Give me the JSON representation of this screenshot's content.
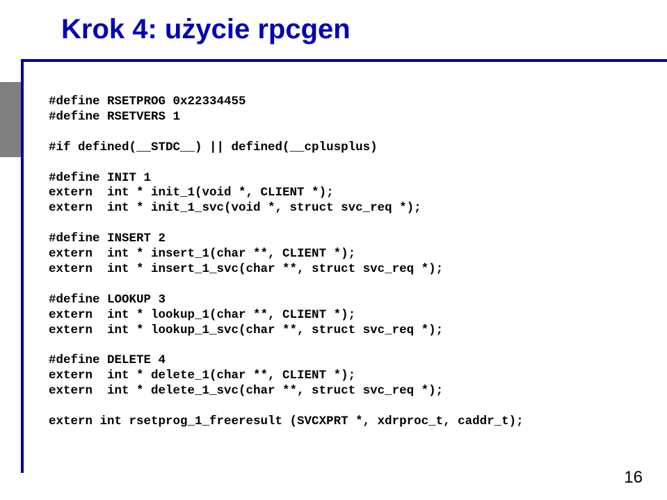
{
  "title": "Krok 4: użycie rpcgen",
  "code": {
    "b1": "#define RSETPROG 0x22334455\n#define RSETVERS 1",
    "b2": "#if defined(__STDC__) || defined(__cplusplus)",
    "b3": "#define INIT 1\nextern  int * init_1(void *, CLIENT *);\nextern  int * init_1_svc(void *, struct svc_req *);",
    "b4": "#define INSERT 2\nextern  int * insert_1(char **, CLIENT *);\nextern  int * insert_1_svc(char **, struct svc_req *);",
    "b5": "#define LOOKUP 3\nextern  int * lookup_1(char **, CLIENT *);\nextern  int * lookup_1_svc(char **, struct svc_req *);",
    "b6": "#define DELETE 4\nextern  int * delete_1(char **, CLIENT *);\nextern  int * delete_1_svc(char **, struct svc_req *);",
    "b7": "extern int rsetprog_1_freeresult (SVCXPRT *, xdrproc_t, caddr_t);"
  },
  "page_number": "16"
}
